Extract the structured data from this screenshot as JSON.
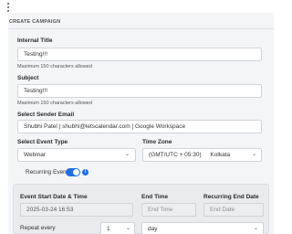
{
  "section_title": "CREATE CAMPAIGN",
  "internal_title": {
    "label": "Internal Title",
    "value": "Testing!!!",
    "hint": "Maximum 150 characters allowed"
  },
  "subject": {
    "label": "Subject",
    "value": "Testing!!!",
    "hint": "Maximum 150 characters allowed"
  },
  "sender_email": {
    "label": "Select Sender Email",
    "value": "Shubhi Patel | shubhi@letscalendar.com | Google Workspace"
  },
  "event_type": {
    "label": "Select Event Type",
    "value": "Webinar"
  },
  "time_zone": {
    "label": "Time Zone",
    "value": "(GMT/UTC + 05:30)",
    "city": "Kolkata"
  },
  "recurring": {
    "label": "Recurring Event",
    "enabled": true,
    "info_icon": "info-icon"
  },
  "schedule": {
    "start_label": "Event Start Date & Time",
    "start_value": "2025-03-24 16:53",
    "end_time_label": "End Time",
    "end_time_placeholder": "End Time",
    "recurring_end_label": "Recurring End Date",
    "recurring_end_placeholder": "End Date",
    "repeat_label": "Repeat every",
    "repeat_count": "1",
    "repeat_unit": "day"
  },
  "colors": {
    "accent": "#1f6feb",
    "panel": "#f4f5f7"
  }
}
